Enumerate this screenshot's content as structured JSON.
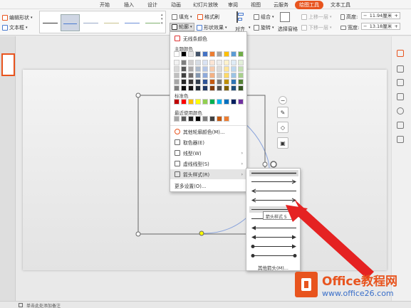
{
  "tabs": [
    "开始",
    "插入",
    "设计",
    "动画",
    "幻灯片放映",
    "审阅",
    "视图",
    "云服务",
    "绘图工具",
    "文本工具"
  ],
  "active_tab": "绘图工具",
  "ribbon": {
    "edit_shape": "编辑形状",
    "text_box": "文本框",
    "fill": "填充",
    "format_painter": "格式刷",
    "outline": "轮廓",
    "shape_effects": "形状效果",
    "align": "对齐",
    "group": "组合",
    "rotate": "旋转",
    "selection_pane": "选择窗格",
    "bring_forward": "上移一层",
    "send_backward": "下移一层",
    "height_label": "高度:",
    "height_value": "11.94厘米",
    "width_label": "宽度:",
    "width_value": "13.18厘米"
  },
  "style_line_colors": [
    "#333333",
    "#4a7bd0",
    "#9aa9c8",
    "#c9c38e",
    "#6d8fd8",
    "#7fb06e"
  ],
  "outline_menu": {
    "no_line": "无线条颜色",
    "theme_colors": "主题颜色",
    "standard_colors": "标准色",
    "recent_colors": "最近使用颜色",
    "more_colors": "其他轮廓颜色(M)...",
    "eyedropper": "取色器(E)",
    "line_weight": "线型(W)",
    "dash_type": "虚线线型(S)",
    "arrow_styles": "箭头样式(R)",
    "more_settings": "更多设置(O)..."
  },
  "theme_palette": {
    "top": [
      "#ffffff",
      "#000000",
      "#e7e6e6",
      "#44546a",
      "#4472c4",
      "#ed7d31",
      "#a5a5a5",
      "#ffc000",
      "#5b9bd5",
      "#70ad47"
    ],
    "shade_columns": [
      [
        "#f2f2f2",
        "#d9d9d9",
        "#bfbfbf",
        "#a6a6a6",
        "#7f7f7f"
      ],
      [
        "#7f7f7f",
        "#595959",
        "#404040",
        "#262626",
        "#0d0d0d"
      ],
      [
        "#d0cece",
        "#aeabab",
        "#757171",
        "#3a3838",
        "#171616"
      ],
      [
        "#d6dce4",
        "#adb9ca",
        "#8497b0",
        "#333f4f",
        "#222a35"
      ],
      [
        "#d9e2f3",
        "#b4c6e7",
        "#8eaadb",
        "#2f5496",
        "#1f3864"
      ],
      [
        "#fbe5d5",
        "#f7cbac",
        "#f4b183",
        "#c55a11",
        "#833c0b"
      ],
      [
        "#ededed",
        "#dbdbdb",
        "#c9c9c9",
        "#7b7b7b",
        "#525252"
      ],
      [
        "#fff2cc",
        "#ffe599",
        "#ffd966",
        "#bf8f00",
        "#7f6000"
      ],
      [
        "#deebf6",
        "#bdd7ee",
        "#9cc3e5",
        "#2e75b5",
        "#1e4e79"
      ],
      [
        "#e2efd9",
        "#c5e0b3",
        "#a8d08d",
        "#538135",
        "#375623"
      ]
    ]
  },
  "standard_palette": [
    "#c00000",
    "#ff0000",
    "#ffc000",
    "#ffff00",
    "#92d050",
    "#00b050",
    "#00b0f0",
    "#0070c0",
    "#002060",
    "#7030a0"
  ],
  "recent_palette": [
    "#a6a6a6",
    "#595959",
    "#262626",
    "#000000",
    "#7f7f7f",
    "#404040",
    "#c55a11",
    "#ed7d31"
  ],
  "arrow_submenu": {
    "tooltip": "箭头样式 5",
    "more_arrows": "其他箭头(M)..."
  },
  "status_bar": {
    "note": "单击此处添加备注"
  },
  "watermark": {
    "brand": "Office教程网",
    "url": "www.office26.com"
  }
}
